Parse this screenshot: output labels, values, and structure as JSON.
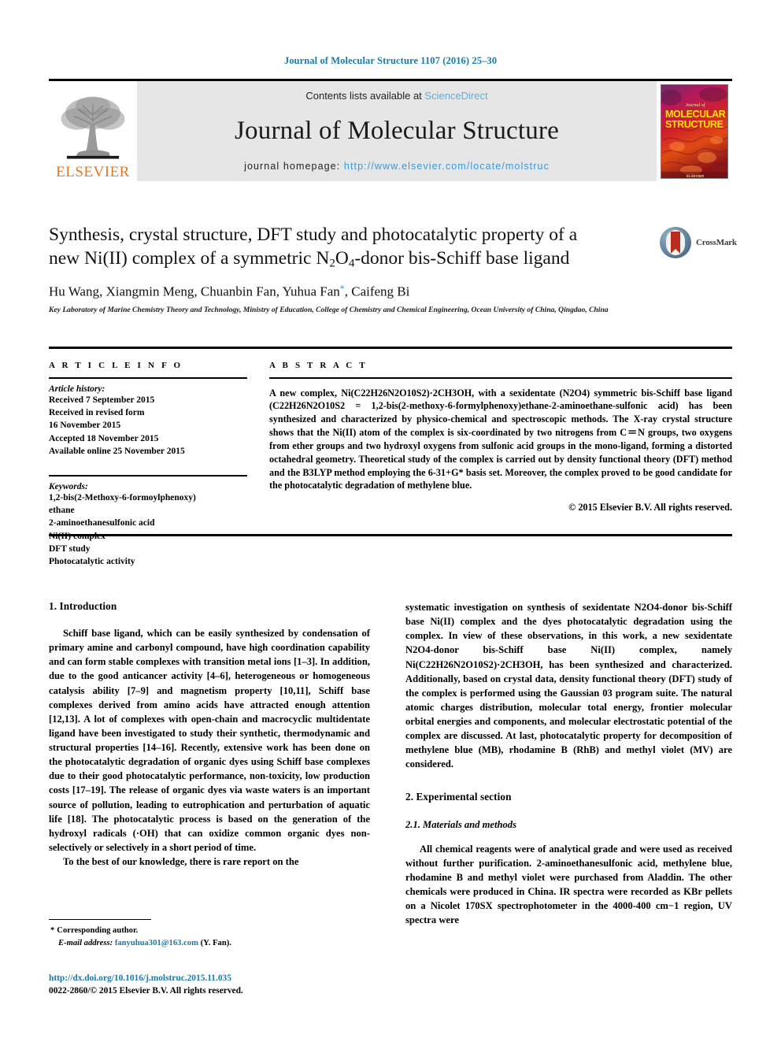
{
  "running_head": "Journal of Molecular Structure 1107 (2016) 25–30",
  "masthead": {
    "contents_prefix": "Contents lists available at ",
    "sciencedirect": "ScienceDirect",
    "journal_title": "Journal of Molecular Structure",
    "homepage_prefix": "journal homepage: ",
    "homepage_url": "http://www.elsevier.com/locate/molstruc",
    "elsevier_wordmark": "ELSEVIER",
    "cover_line1": "Journal of",
    "cover_line2": "MOLECULAR",
    "cover_line3": "STRUCTURE",
    "cover_publisher": "ELSEVIER",
    "accent_blue": "#1a7ba8",
    "link_blue": "#3b9ad6",
    "elsevier_orange": "#e87722",
    "band_gray": "#e6e6e6"
  },
  "article": {
    "title_line1": "Synthesis, crystal structure, DFT study and photocatalytic property of a",
    "title_line2_a": "new Ni(II) complex of a symmetric N",
    "title_line2_sub1": "2",
    "title_line2_b": "O",
    "title_line2_sub2": "4",
    "title_line2_c": "-donor bis-Schiff base ligand",
    "crossmark_label": "CrossMark",
    "authors": "Hu Wang, Xiangmin Meng, Chuanbin Fan, Yuhua Fan",
    "authors_star": "*",
    "authors_tail": ", Caifeng Bi",
    "affiliation": "Key Laboratory of Marine Chemistry Theory and Technology, Ministry of Education, College of Chemistry and Chemical Engineering, Ocean University of China, Qingdao, China"
  },
  "article_info": {
    "heading": "A R T I C L E   I N F O",
    "history_label": "Article history:",
    "history": [
      "Received 7 September 2015",
      "Received in revised form",
      "16 November 2015",
      "Accepted 18 November 2015",
      "Available online 25 November 2015"
    ],
    "keywords_label": "Keywords:",
    "keywords": [
      "1,2-bis(2-Methoxy-6-formoylphenoxy)",
      "ethane",
      "2-aminoethanesulfonic acid",
      "Ni(II) complex",
      "DFT study",
      "Photocatalytic activity"
    ]
  },
  "abstract": {
    "heading": "A B S T R A C T",
    "text": "A new complex, Ni(C22H26N2O10S2)·2CH3OH, with a sexidentate (N2O4) symmetric bis-Schiff base ligand (C22H26N2O10S2 = 1,2-bis(2-methoxy-6-formylphenoxy)ethane-2-aminoethane-sulfonic acid) has been synthesized and characterized by physico-chemical and spectroscopic methods. The X-ray crystal structure shows that the Ni(II) atom of the complex is six-coordinated by two nitrogens from C＝N groups, two oxygens from ether groups and two hydroxyl oxygens from sulfonic acid groups in the mono-ligand, forming a distorted octahedral geometry. Theoretical study of the complex is carried out by density functional theory (DFT) method and the B3LYP method employing the 6-31+G* basis set. Moreover, the complex proved to be good candidate for the photocatalytic degradation of methylene blue.",
    "copyright": "© 2015 Elsevier B.V. All rights reserved."
  },
  "body": {
    "intro_heading": "1. Introduction",
    "intro_p1": "Schiff base ligand, which can be easily synthesized by condensation of primary amine and carbonyl compound, have high coordination capability and can form stable complexes with transition metal ions [1–3]. In addition, due to the good anticancer activity [4–6], heterogeneous or homogeneous catalysis ability [7–9] and magnetism property [10,11], Schiff base complexes derived from amino acids have attracted enough attention [12,13]. A lot of complexes with open-chain and macrocyclic multidentate ligand have been investigated to study their synthetic, thermodynamic and structural properties [14–16]. Recently, extensive work has been done on the photocatalytic degradation of organic dyes using Schiff base complexes due to their good photocatalytic performance, non-toxicity, low production costs [17–19]. The release of organic dyes via waste waters is an important source of pollution, leading to eutrophication and perturbation of aquatic life [18]. The photocatalytic process is based on the generation of the hydroxyl radicals (·OH) that can oxidize common organic dyes non-selectively or selectively in a short period of time.",
    "intro_p2": "To the best of our knowledge, there is rare report on the",
    "right_p1": "systematic investigation on synthesis of sexidentate N2O4-donor bis-Schiff base Ni(II) complex and the dyes photocatalytic degradation using the complex. In view of these observations, in this work, a new sexidentate N2O4-donor bis-Schiff base Ni(II) complex, namely Ni(C22H26N2O10S2)·2CH3OH, has been synthesized and characterized. Additionally, based on crystal data, density functional theory (DFT) study of the complex is performed using the Gaussian 03 program suite. The natural atomic charges distribution, molecular total energy, frontier molecular orbital energies and components, and molecular electrostatic potential of the complex are discussed. At last, photocatalytic property for decomposition of methylene blue (MB), rhodamine B (RhB) and methyl violet (MV) are considered.",
    "exp_heading": "2. Experimental section",
    "exp_sub_heading": "2.1. Materials and methods",
    "exp_p1": "All chemical reagents were of analytical grade and were used as received without further purification. 2-aminoethanesulfonic acid, methylene blue, rhodamine B and methyl violet were purchased from Aladdin. The other chemicals were produced in China. IR spectra were recorded as KBr pellets on a Nicolet 170SX spectrophotometer in the 4000-400 cm−1 region, UV spectra were"
  },
  "footnote": {
    "corresponding": "Corresponding author.",
    "email_label": "E-mail address:",
    "email": "fanyuhua301@163.com",
    "email_tail": "(Y. Fan).",
    "doi": "http://dx.doi.org/10.1016/j.molstruc.2015.11.035",
    "issn": "0022-2860/© 2015 Elsevier B.V. All rights reserved."
  }
}
